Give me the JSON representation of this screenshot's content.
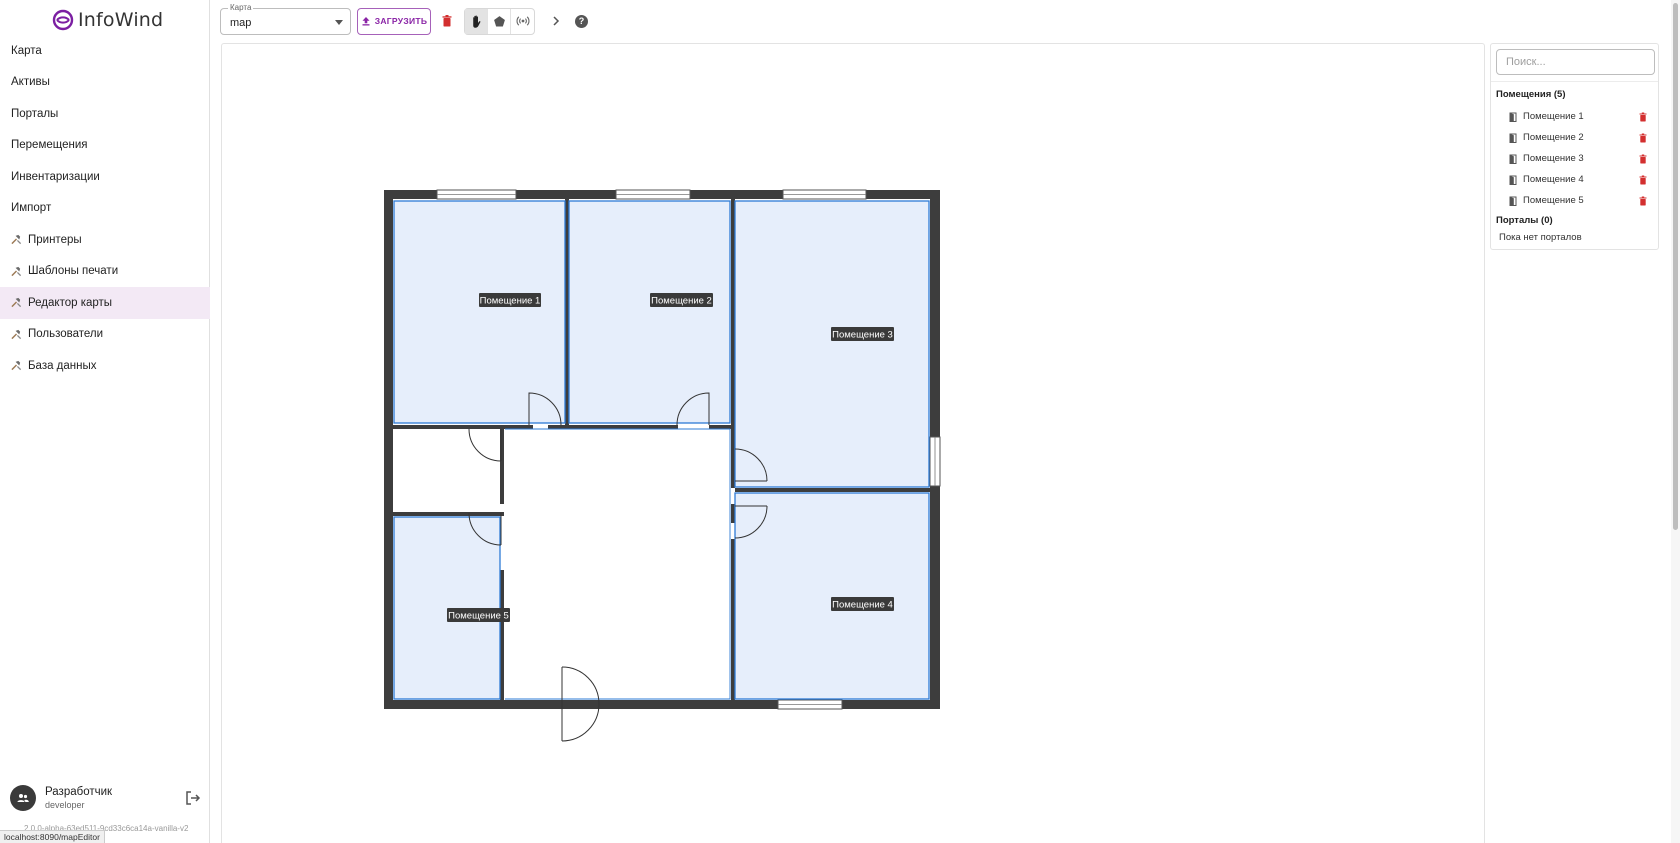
{
  "app": {
    "logo_text": "InfoWind",
    "brand_color": "#7b1fa2"
  },
  "sidebar": {
    "items": [
      {
        "label": "Карта",
        "tool": false,
        "active": false
      },
      {
        "label": "Активы",
        "tool": false,
        "active": false
      },
      {
        "label": "Порталы",
        "tool": false,
        "active": false
      },
      {
        "label": "Перемещения",
        "tool": false,
        "active": false
      },
      {
        "label": "Инвентаризации",
        "tool": false,
        "active": false
      },
      {
        "label": "Импорт",
        "tool": false,
        "active": false
      },
      {
        "label": "Принтеры",
        "tool": true,
        "active": false
      },
      {
        "label": "Шаблоны печати",
        "tool": true,
        "active": false
      },
      {
        "label": "Редактор карты",
        "tool": true,
        "active": true
      },
      {
        "label": "Пользователи",
        "tool": true,
        "active": false
      },
      {
        "label": "База данных",
        "tool": true,
        "active": false
      }
    ],
    "user": {
      "name": "Разработчик",
      "login": "developer"
    },
    "version": "2.0.0-alpha-63ed511-9cd33c6ca14a-vanilla-v2",
    "status_url": "localhost:8090/mapEditor"
  },
  "toolbar": {
    "map_select_label": "Карта",
    "map_select_value": "map",
    "upload_label": "ЗАГРУЗИТЬ",
    "modes": [
      "pan",
      "polygon",
      "portal"
    ],
    "active_mode": "pan",
    "delete_color": "#d32f2f"
  },
  "floor_plan": {
    "rooms": [
      {
        "label": "Помещение 1"
      },
      {
        "label": "Помещение 2"
      },
      {
        "label": "Помещение 3"
      },
      {
        "label": "Помещение 4"
      },
      {
        "label": "Помещение 5"
      }
    ],
    "room_fill": "#e6eefb",
    "room_stroke": "#2e7bd6",
    "wall_color": "#3d3d3d"
  },
  "right_panel": {
    "search_placeholder": "Поиск...",
    "rooms_title": "Помещения (5)",
    "rooms": [
      "Помещение 1",
      "Помещение 2",
      "Помещение 3",
      "Помещение 4",
      "Помещение 5"
    ],
    "portals_title": "Порталы (0)",
    "portals_empty": "Пока нет порталов"
  }
}
